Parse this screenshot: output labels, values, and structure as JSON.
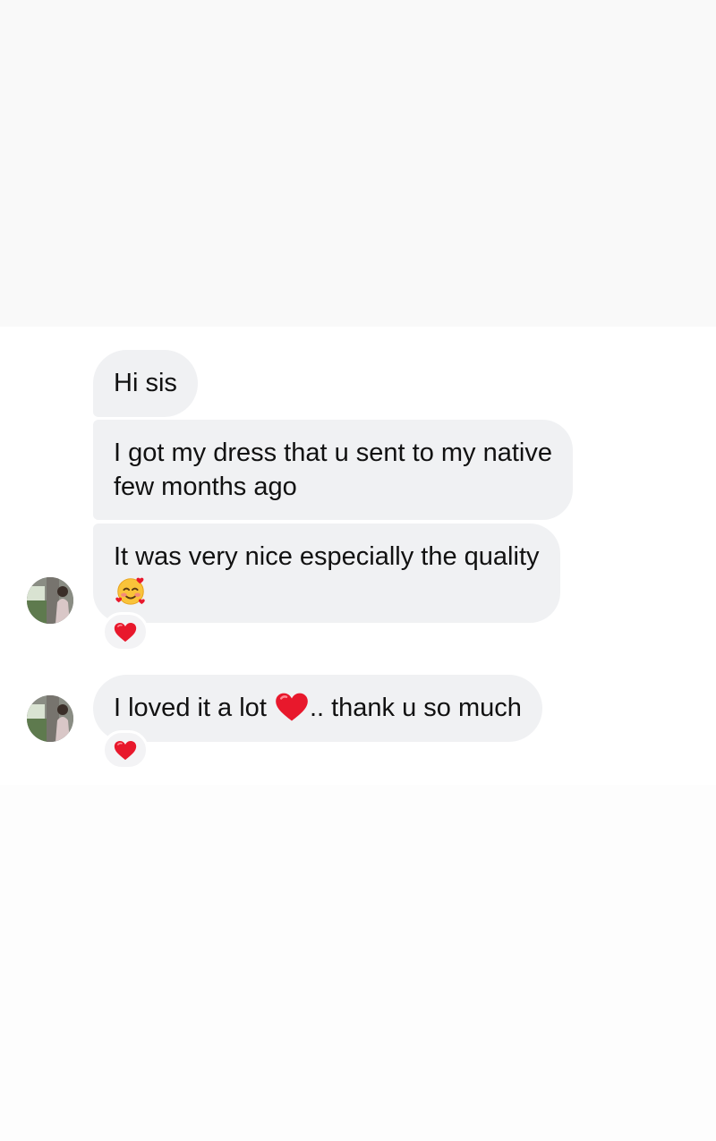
{
  "conversation": {
    "messages": [
      {
        "lines": [
          "Hi sis"
        ]
      },
      {
        "lines": [
          "I got my dress that u sent to my native",
          "few months ago"
        ]
      },
      {
        "lines": [
          "It was very nice especially the quality"
        ],
        "trailing_emoji": "smiling-face-with-hearts-icon",
        "reaction": "red-heart-icon"
      },
      {
        "text_before_emoji": "I loved it a lot ",
        "inline_emoji": "red-heart-icon",
        "text_after_emoji": ".. thank u so much",
        "reaction": "red-heart-icon"
      }
    ]
  },
  "colors": {
    "bubble": "#f0f1f3",
    "background": "#ffffff",
    "heart": "#e8182c"
  }
}
